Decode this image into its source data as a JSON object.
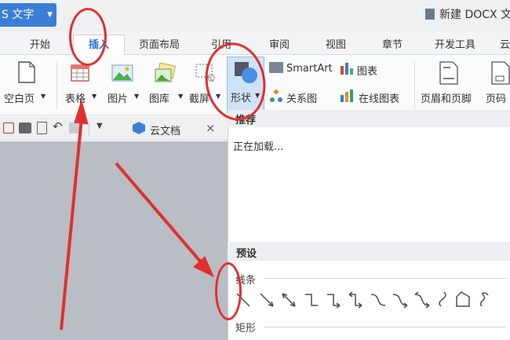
{
  "app": {
    "name": "S 文字",
    "doc_title": "新建 DOCX 文"
  },
  "tabs": [
    "开始",
    "插入",
    "页面布局",
    "引用",
    "审阅",
    "视图",
    "章节",
    "开发工具",
    "云"
  ],
  "ribbon": {
    "blank_page": "空白页",
    "table": "表格",
    "picture": "图片",
    "gallery": "图库",
    "screenshot": "截屏",
    "shape": "形状",
    "smartart": "SmartArt",
    "chart": "图表",
    "relation": "关系图",
    "online_chart": "在线图表",
    "header_footer": "页眉和页脚",
    "page_num": "页码"
  },
  "quick": {
    "cloud_doc": "云文档",
    "close": "×"
  },
  "panel": {
    "recommend": "推荐",
    "loading": "正在加载...",
    "preset": "预设",
    "lines": "线条",
    "rect": "矩形"
  },
  "colors": {
    "accent": "#3a7fd5",
    "annotation": "#e03030"
  }
}
